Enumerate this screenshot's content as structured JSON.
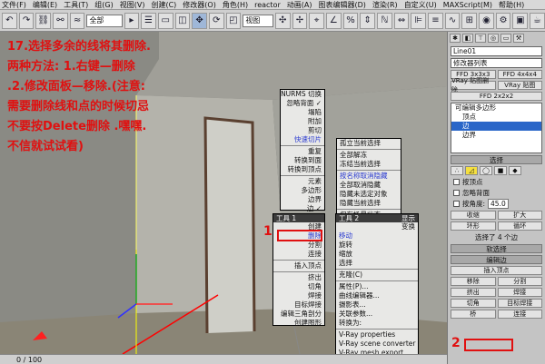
{
  "menu": [
    "文件(F)",
    "编辑(E)",
    "工具(T)",
    "组(G)",
    "视图(V)",
    "创建(C)",
    "修改器(O)",
    "角色(H)",
    "reactor",
    "动画(A)",
    "图表编辑器(D)",
    "渲染(R)",
    "自定义(U)",
    "MAXScript(M)",
    "帮助(H)"
  ],
  "toolbar": {
    "selection_filter": "全部",
    "view_dropdown": "视图"
  },
  "annotation": {
    "step_text": "17.选择多余的线将其删除.两种方法: 1.右键—删除 .2.修改面板—移除.(注意:需要删除线和点的时候切忌不要按Delete删除 .嘿嘿.不信就试试看)",
    "marker_1": "1",
    "marker_2": "2"
  },
  "quad_top_left": {
    "items": [
      "NURMS 切换",
      "忽略背面 ✓",
      "塌陷",
      "附加",
      "剪切",
      "快速切片",
      "重复",
      "转换到面",
      "转换到顶点",
      "元素",
      "多边形",
      "边界",
      "边 ✓",
      "顶点",
      "顶层级"
    ]
  },
  "quad_top_right": {
    "items": [
      "孤立当前选择",
      "全部解冻",
      "冻结当前选择",
      "按名称取消隐藏",
      "全部取消隐藏",
      "隐藏未选定对象",
      "隐藏当前选择",
      "保存场景状态...",
      "管理场景状态..."
    ]
  },
  "quad_bottom_left": {
    "header_left": "工具 1",
    "items": [
      "创建",
      "删除",
      "分割",
      "连接",
      "插入顶点",
      "挤出",
      "切角",
      "焊接",
      "目标焊接",
      "编辑三角剖分",
      "创建图形"
    ]
  },
  "quad_bottom_right": {
    "header_left": "工具 2",
    "header_right": "显示",
    "extra": "变换",
    "items": [
      "移动",
      "旋转",
      "缩放",
      "选择",
      "克隆(C)",
      "属性(P)...",
      "曲线编辑器...",
      "摄影表...",
      "关联参数...",
      "转换为:",
      "V-Ray properties",
      "V-Ray scene converter",
      "V-Ray mesh export",
      "V-Ray VFB"
    ]
  },
  "panel": {
    "object_name": "Line01",
    "modifier_list": "修改器列表",
    "buttons_row1": [
      "FFD 3x3x3",
      "FFD 4x4x4"
    ],
    "buttons_row2": [
      "VRay 贴图删除",
      "VRay 贴图"
    ],
    "buttons_row3": [
      "FFD 2x2x2"
    ],
    "stack": [
      "可编辑多边形",
      "顶点",
      "边",
      "边界"
    ],
    "selection_rollout": "选择",
    "check_by_vertex": "按顶点",
    "check_ignore_backface": "忽略背面",
    "angle_label": "按角度:",
    "angle_value": "45.0",
    "shrink": "收缩",
    "grow": "扩大",
    "ring": "环形",
    "loop": "循环",
    "selected_count": "选择了 4 个边",
    "soft_select": "软选择",
    "edit_edges": "编辑边",
    "insert_vertex": "插入顶点",
    "remove": "移除",
    "split": "分割",
    "extrude": "挤出",
    "weld": "焊接",
    "chamfer": "切角",
    "target_weld": "目标焊接",
    "bridge": "桥",
    "connect": "连接"
  },
  "status": {
    "frame": "0 / 100"
  }
}
